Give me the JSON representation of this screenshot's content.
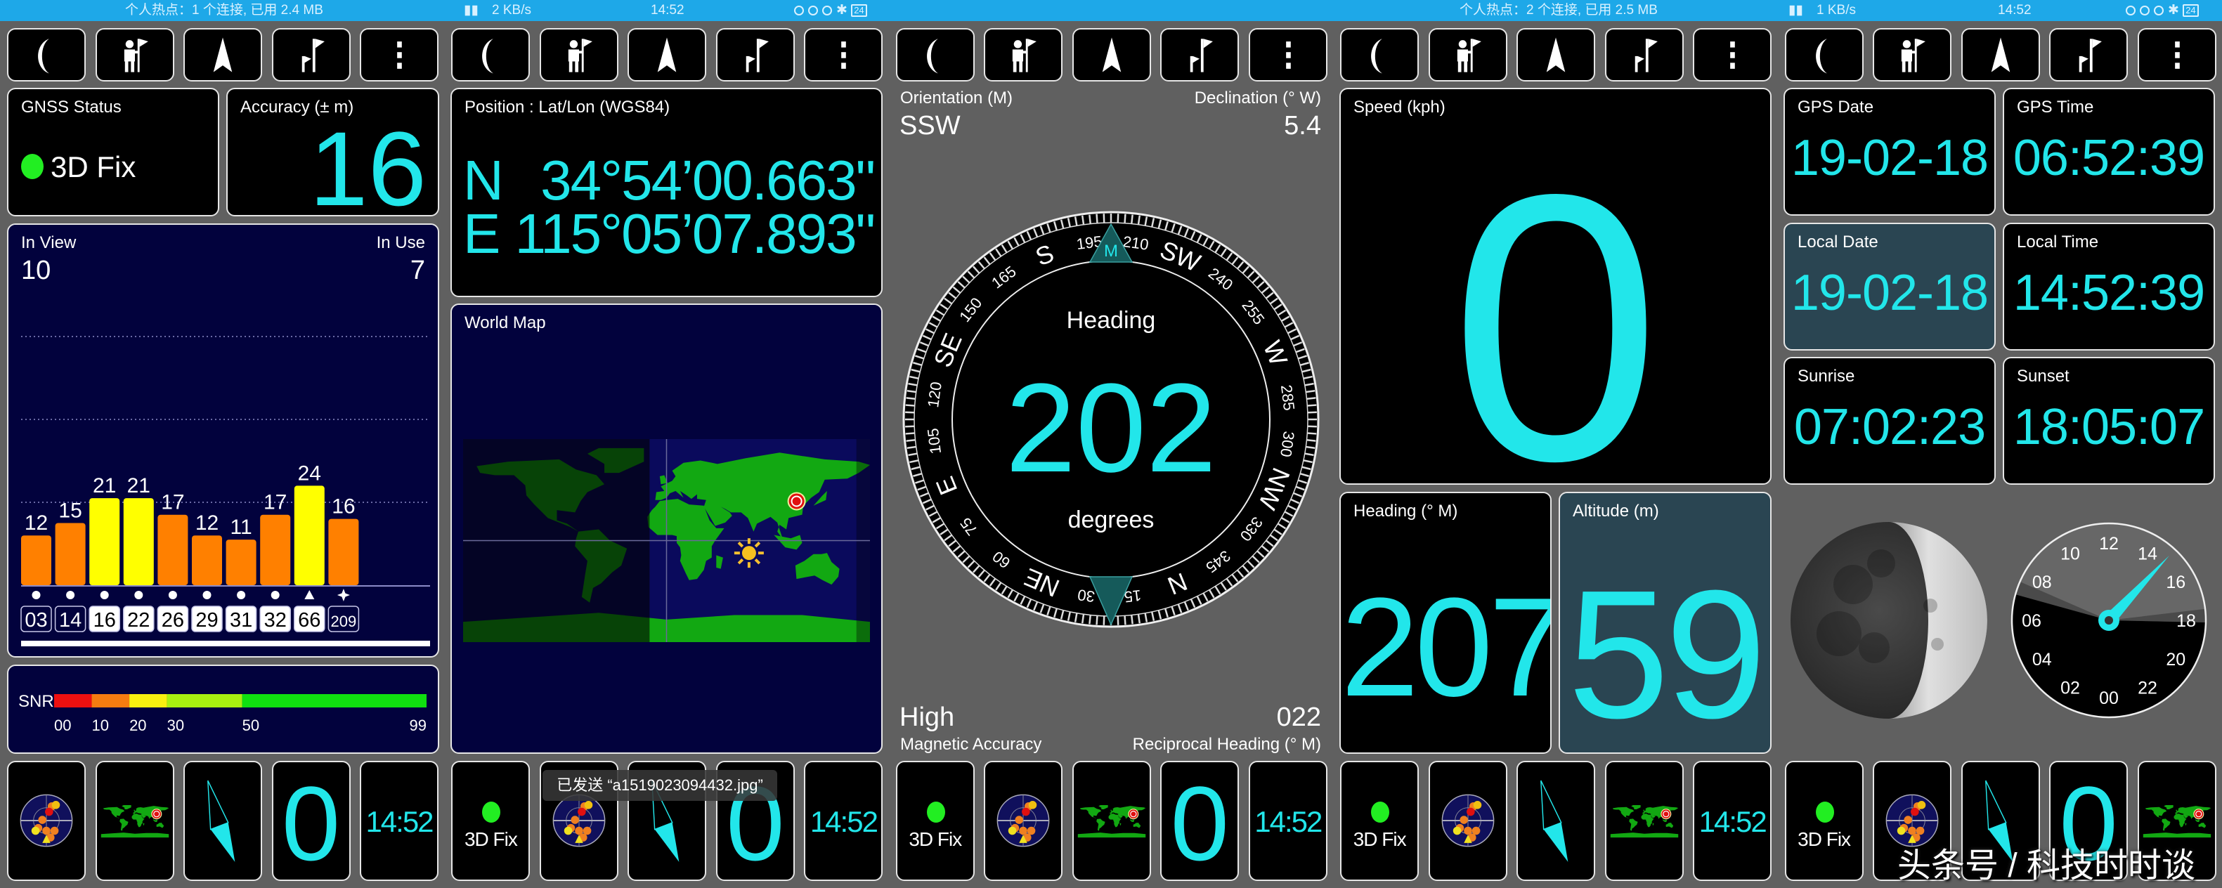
{
  "status_bars": [
    {
      "hotspot": "个人热点：1 个连接, 已用 2.4 MB",
      "net_speed": "2 KB/s",
      "time": "14:52",
      "battery": "24"
    },
    {
      "hotspot": "个人热点：2 个连接, 已用 2.5 MB",
      "net_speed": "1 KB/s",
      "time": "14:52",
      "battery": "24"
    }
  ],
  "top_toolbar": {
    "icons": [
      "moon-icon",
      "person-flag-icon",
      "navigation-arrow-icon",
      "flag-icon",
      "more-vert-icon"
    ],
    "panels": 5
  },
  "gnss": {
    "label": "GNSS Status",
    "fix": "3D Fix",
    "fix_color": "#22ee22"
  },
  "accuracy": {
    "label": "Accuracy (± m)",
    "value": "16"
  },
  "satellites": {
    "in_view_label": "In View",
    "in_view": "10",
    "in_use_label": "In Use",
    "in_use": "7"
  },
  "snr_legend": {
    "label": "SNR",
    "ticks": [
      "00",
      "10",
      "20",
      "30",
      "50",
      "99"
    ],
    "segments": [
      {
        "from": 0,
        "to": 10,
        "color": "#ee1010"
      },
      {
        "from": 10,
        "to": 20,
        "color": "#f57c10"
      },
      {
        "from": 20,
        "to": 30,
        "color": "#f8f010"
      },
      {
        "from": 30,
        "to": 50,
        "color": "#a8f010"
      },
      {
        "from": 50,
        "to": 99,
        "color": "#10e010"
      }
    ]
  },
  "position": {
    "label": "Position : Lat/Lon (WGS84)",
    "lat_hemi": "N",
    "lat": "34°54’00.663\"",
    "lon_hemi": "E",
    "lon": "115°05’07.893\"",
    "lat_deg": 34.9,
    "lon_deg": 115.085
  },
  "world_map": {
    "label": "World Map"
  },
  "compass": {
    "orientation_label": "Orientation (M)",
    "orientation": "SSW",
    "declination_label": "Declination (° W)",
    "declination": "5.4",
    "heading_label": "Heading",
    "heading": "202",
    "heading_unit": "degrees",
    "marker": "M",
    "magnetic_accuracy": "High",
    "magnetic_accuracy_label": "Magnetic Accuracy",
    "reciprocal": "022",
    "reciprocal_label": "Reciprocal Heading (° M)",
    "dial_labels": [
      {
        "deg": 0,
        "text": "N"
      },
      {
        "deg": 15,
        "text": "15"
      },
      {
        "deg": 30,
        "text": "30"
      },
      {
        "deg": 45,
        "text": "NE"
      },
      {
        "deg": 60,
        "text": "60"
      },
      {
        "deg": 75,
        "text": "75"
      },
      {
        "deg": 90,
        "text": "E"
      },
      {
        "deg": 105,
        "text": "105"
      },
      {
        "deg": 120,
        "text": "120"
      },
      {
        "deg": 135,
        "text": "SE"
      },
      {
        "deg": 150,
        "text": "150"
      },
      {
        "deg": 165,
        "text": "165"
      },
      {
        "deg": 180,
        "text": "S"
      },
      {
        "deg": 195,
        "text": "195"
      },
      {
        "deg": 210,
        "text": "210"
      },
      {
        "deg": 225,
        "text": "SW"
      },
      {
        "deg": 240,
        "text": "240"
      },
      {
        "deg": 255,
        "text": "255"
      },
      {
        "deg": 270,
        "text": "W"
      },
      {
        "deg": 285,
        "text": "285"
      },
      {
        "deg": 300,
        "text": "300"
      },
      {
        "deg": 315,
        "text": "NW"
      },
      {
        "deg": 330,
        "text": "330"
      },
      {
        "deg": 345,
        "text": "345"
      }
    ]
  },
  "speed": {
    "label": "Speed (kph)",
    "value": "0"
  },
  "heading_card": {
    "label": "Heading (° M)",
    "value": "207"
  },
  "altitude": {
    "label": "Altitude (m)",
    "value": "59"
  },
  "times": {
    "gps_date_label": "GPS Date",
    "gps_date": "19-02-18",
    "gps_time_label": "GPS Time",
    "gps_time": "06:52:39",
    "local_date_label": "Local Date",
    "local_date": "19-02-18",
    "local_time_label": "Local Time",
    "local_time": "14:52:39",
    "sunrise_label": "Sunrise",
    "sunrise": "07:02:23",
    "sunset_label": "Sunset",
    "sunset": "18:05:07"
  },
  "moon": {
    "lit_fraction": 0.3,
    "waxing": true
  },
  "day_clock": {
    "labels": [
      "00",
      "02",
      "04",
      "06",
      "08",
      "10",
      "12",
      "14",
      "16",
      "18",
      "20",
      "22"
    ],
    "hand_time": "14:52",
    "sunrise": "07:02",
    "sunset": "18:05",
    "hand_color": "#22e6ea"
  },
  "bottom_tiles": {
    "speed": "0",
    "time": "14:52",
    "fix": "3D Fix",
    "panels": [
      [
        "radar",
        "map",
        "needle",
        "speed",
        "time"
      ],
      [
        "fix",
        "radar",
        "needle",
        "speed",
        "time"
      ],
      [
        "fix",
        "radar",
        "map",
        "speed",
        "time"
      ],
      [
        "fix",
        "radar",
        "needle",
        "map",
        "time"
      ],
      [
        "fix",
        "radar",
        "needle",
        "speed",
        "map"
      ]
    ]
  },
  "toast": "已发送 “a1519023094432.jpg”",
  "watermark": "头条号 / 科技时时谈",
  "colors": {
    "accent": "#22e6ea",
    "bar_high": "#ffff00",
    "bar_low": "#ff8000",
    "navy": "#02023d",
    "teal": "#2a4552"
  },
  "chart_data": {
    "type": "bar",
    "title": "",
    "categories": [
      "03",
      "14",
      "16",
      "22",
      "26",
      "29",
      "31",
      "32",
      "66",
      "209"
    ],
    "values": [
      12,
      15,
      21,
      21,
      17,
      12,
      11,
      17,
      24,
      16
    ],
    "in_use": [
      false,
      false,
      true,
      true,
      true,
      true,
      true,
      true,
      true,
      false
    ],
    "markers": [
      "circle",
      "circle",
      "circle",
      "circle",
      "circle",
      "circle",
      "circle",
      "circle",
      "triangle",
      "star"
    ],
    "gridlines": [
      20,
      40,
      60
    ],
    "grid": true,
    "legend": "none"
  }
}
